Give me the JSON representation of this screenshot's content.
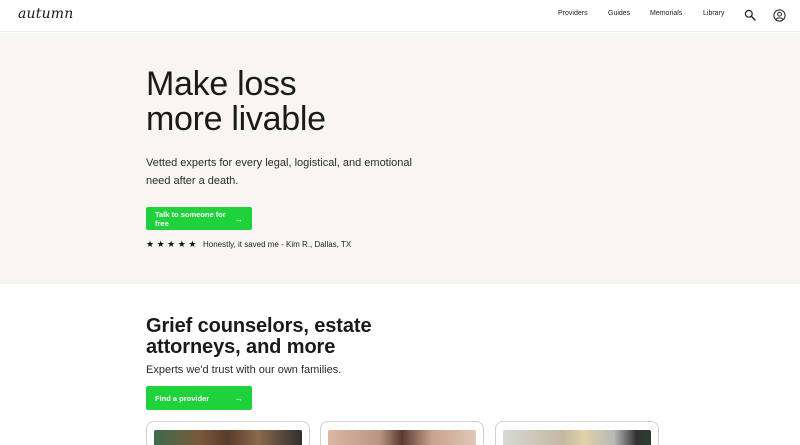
{
  "header": {
    "logo": "autumn",
    "nav": [
      "Providers",
      "Guides",
      "Memorials",
      "Library"
    ],
    "icons": [
      "search-icon",
      "account-icon"
    ]
  },
  "hero": {
    "title_line1": "Make loss",
    "title_line2": "more livable",
    "subtitle": "Vetted experts for every legal, logistical, and emotional need after a death.",
    "cta_label": "Talk to someone for free",
    "rating_stars": 5,
    "testimonial": "Honestly, it saved me - Kim R., Dallas, TX"
  },
  "providers_section": {
    "title": "Grief counselors, estate attorneys, and more",
    "subtitle": "Experts we'd trust with our own families.",
    "cta_label": "Find a provider"
  },
  "colors": {
    "accent": "#1fd13b",
    "hero_background": "#f9f5f2",
    "text": "#1a1a1a"
  }
}
